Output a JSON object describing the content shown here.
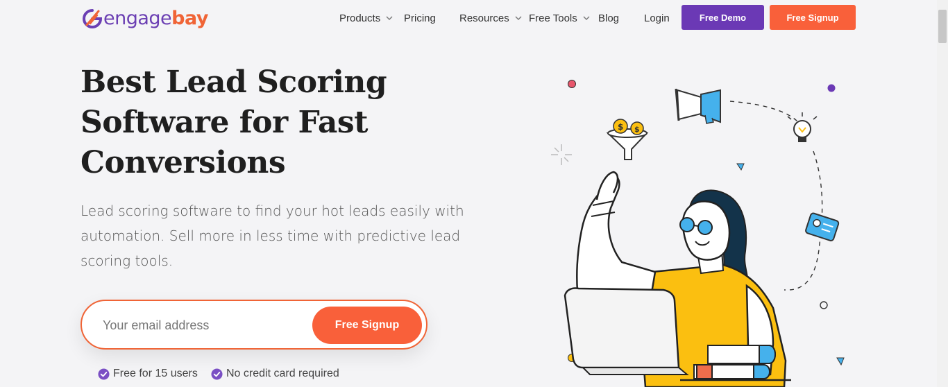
{
  "header": {
    "logo": {
      "engage": "engage",
      "bay": "bay"
    },
    "nav": [
      {
        "label": "Products",
        "dropdown": true
      },
      {
        "label": "Pricing",
        "dropdown": false
      },
      {
        "label": "Resources",
        "dropdown": true
      },
      {
        "label": "Free Tools",
        "dropdown": true
      },
      {
        "label": "Blog",
        "dropdown": false
      },
      {
        "label": "Login",
        "dropdown": false
      }
    ],
    "demo_label": "Free Demo",
    "signup_label": "Free Signup"
  },
  "hero": {
    "title_lines": [
      "Best Lead Scoring",
      "Software for Fast",
      "Conversions"
    ],
    "subtitle_lines": [
      "Lead scoring software to find your hot leads easily with",
      "automation. Sell more in less time with predictive lead",
      "scoring tools."
    ],
    "form": {
      "email_placeholder": "Your email address",
      "button_label": "Free Signup"
    },
    "checks": [
      "Free for 15 users",
      "No credit card required"
    ]
  },
  "colors": {
    "brand_purple": "#6b39b5",
    "brand_orange": "#f9603a",
    "accent_yellow": "#fbbf10",
    "accent_blue": "#45b1ec"
  },
  "icons": [
    "engagebay-logo-icon",
    "chevron-down-icon",
    "check-circle-icon",
    "megaphone-icon",
    "lightbulb-icon",
    "funnel-icon",
    "id-card-icon",
    "laptop-icon",
    "books-icon"
  ]
}
